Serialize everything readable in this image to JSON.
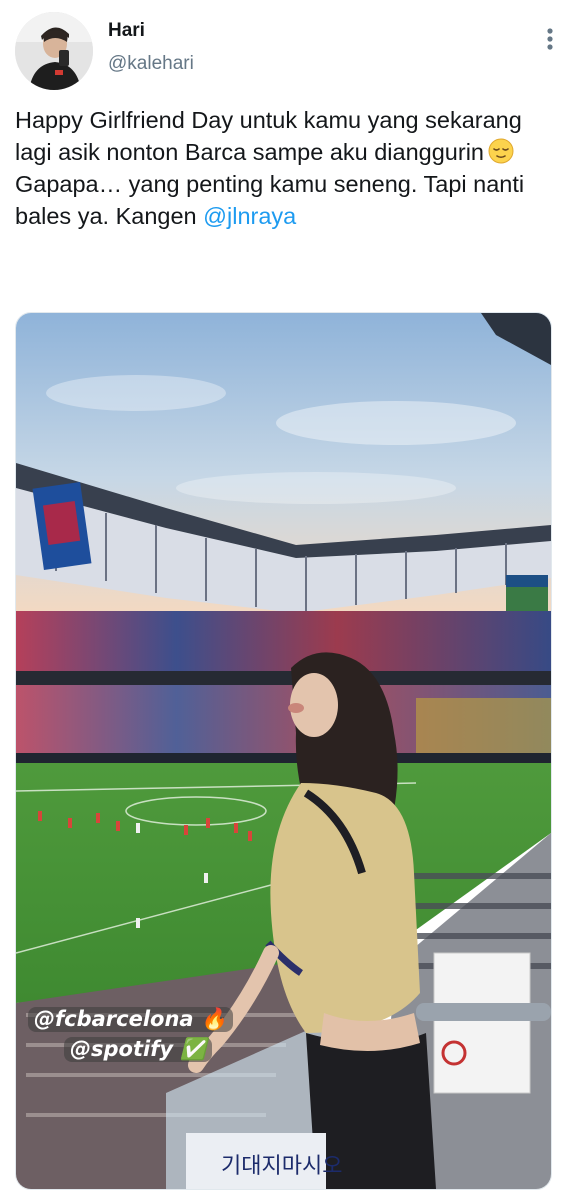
{
  "user": {
    "display_name": "Hari",
    "handle": "@kalehari"
  },
  "tweet": {
    "line1": "Happy Girlfriend Day untuk kamu yang sekarang lagi asik nonton Barca sampe aku dianggurin",
    "line1_emoji": "relieved-face-icon",
    "line2_text": "Gapapa… yang penting kamu seneng. Tapi nanti bales ya. Kangen ",
    "mention": "@jlnraya"
  },
  "media": {
    "sticker1": "@fcbarcelona 🔥",
    "sticker2": "@spotify ✅",
    "sign_text": "기대지마시오"
  },
  "icons": {
    "more": "more-vertical-icon"
  },
  "colors": {
    "link": "#1d9bf0",
    "secondary_text": "#657786"
  }
}
